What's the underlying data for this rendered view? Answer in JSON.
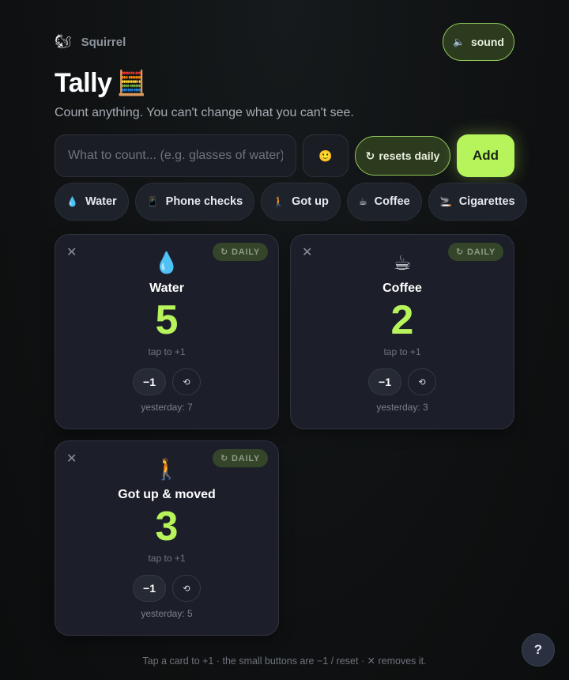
{
  "brand": {
    "logo": "🐿",
    "name": "Squirrel"
  },
  "sound_button": {
    "icon": "🔈",
    "label": "sound"
  },
  "header": {
    "title": "Tally",
    "title_emoji": "🧮",
    "subtitle": "Count anything. You can't change what you can't see."
  },
  "input_row": {
    "placeholder": "What to count... (e.g. glasses of water)",
    "emoji_button": "🙂",
    "reset_icon": "↻",
    "reset_label": "resets daily",
    "add_label": "Add"
  },
  "presets": [
    {
      "icon": "💧",
      "label": "Water"
    },
    {
      "icon": "📱",
      "label": "Phone checks"
    },
    {
      "icon": "🚶",
      "label": "Got up"
    },
    {
      "icon": "☕",
      "label": "Coffee"
    },
    {
      "icon": "🚬",
      "label": "Cigarettes"
    }
  ],
  "cards": [
    {
      "emoji": "💧",
      "name": "Water",
      "value": "5",
      "badge": "DAILY",
      "hint": "tap to +1",
      "minus": "−1",
      "reset": "⟲",
      "yesterday": "yesterday: 7"
    },
    {
      "emoji": "☕",
      "name": "Coffee",
      "value": "2",
      "badge": "DAILY",
      "hint": "tap to +1",
      "minus": "−1",
      "reset": "⟲",
      "yesterday": "yesterday: 3"
    },
    {
      "emoji": "🚶",
      "name": "Got up & moved",
      "value": "3",
      "badge": "DAILY",
      "hint": "tap to +1",
      "minus": "−1",
      "reset": "⟲",
      "yesterday": "yesterday: 5"
    }
  ],
  "card_common": {
    "close": "✕",
    "badge_icon": "↻"
  },
  "footer": "Tap a card to +1 · the small buttons are −1 / reset · ✕ removes it.",
  "help_button": "?",
  "colors": {
    "accent": "#b7f45c",
    "background": "#0f1112",
    "card": "#1c1f29"
  }
}
